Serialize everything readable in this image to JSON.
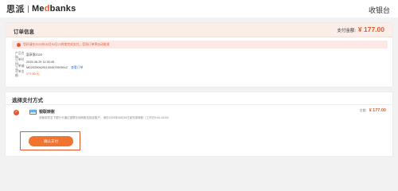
{
  "header": {
    "brand_cn": "思派",
    "brand_en_prefix": "Me",
    "brand_en_accent": "d",
    "brand_en_suffix": "banks",
    "title": "收银台"
  },
  "order": {
    "title": "订单信息",
    "amount_label": "支付金额:",
    "amount_value": "¥ 177.00",
    "notice": "您好请在2025年06月30日23时前完成支付，否则订单将自动取消",
    "info": [
      {
        "label": "产品名称:",
        "value": "惠享保2025"
      },
      {
        "label": "订单时间:",
        "value": "2025-06-29 11:30:45"
      },
      {
        "label": "订单编号:",
        "value": "MD2025062911304570505012",
        "link": "查看订单"
      },
      {
        "label": "订单金额:",
        "value": "177.00 元"
      }
    ]
  },
  "payment": {
    "title": "选择支付方式",
    "method": {
      "name": "银联转账",
      "description": "请使用您名下银行卡通过银联在线转账至指定账户，请在2025年06月30日前完成转账（工作日9:00-18:00）",
      "price_label": "金额:",
      "price": "¥ 177.00",
      "selected": true
    },
    "confirm_label": "确认支付"
  },
  "colors": {
    "accent": "#e8572a",
    "button": "#f0732f",
    "notice_bg": "#fde8e6",
    "link": "#2f7cd9"
  }
}
